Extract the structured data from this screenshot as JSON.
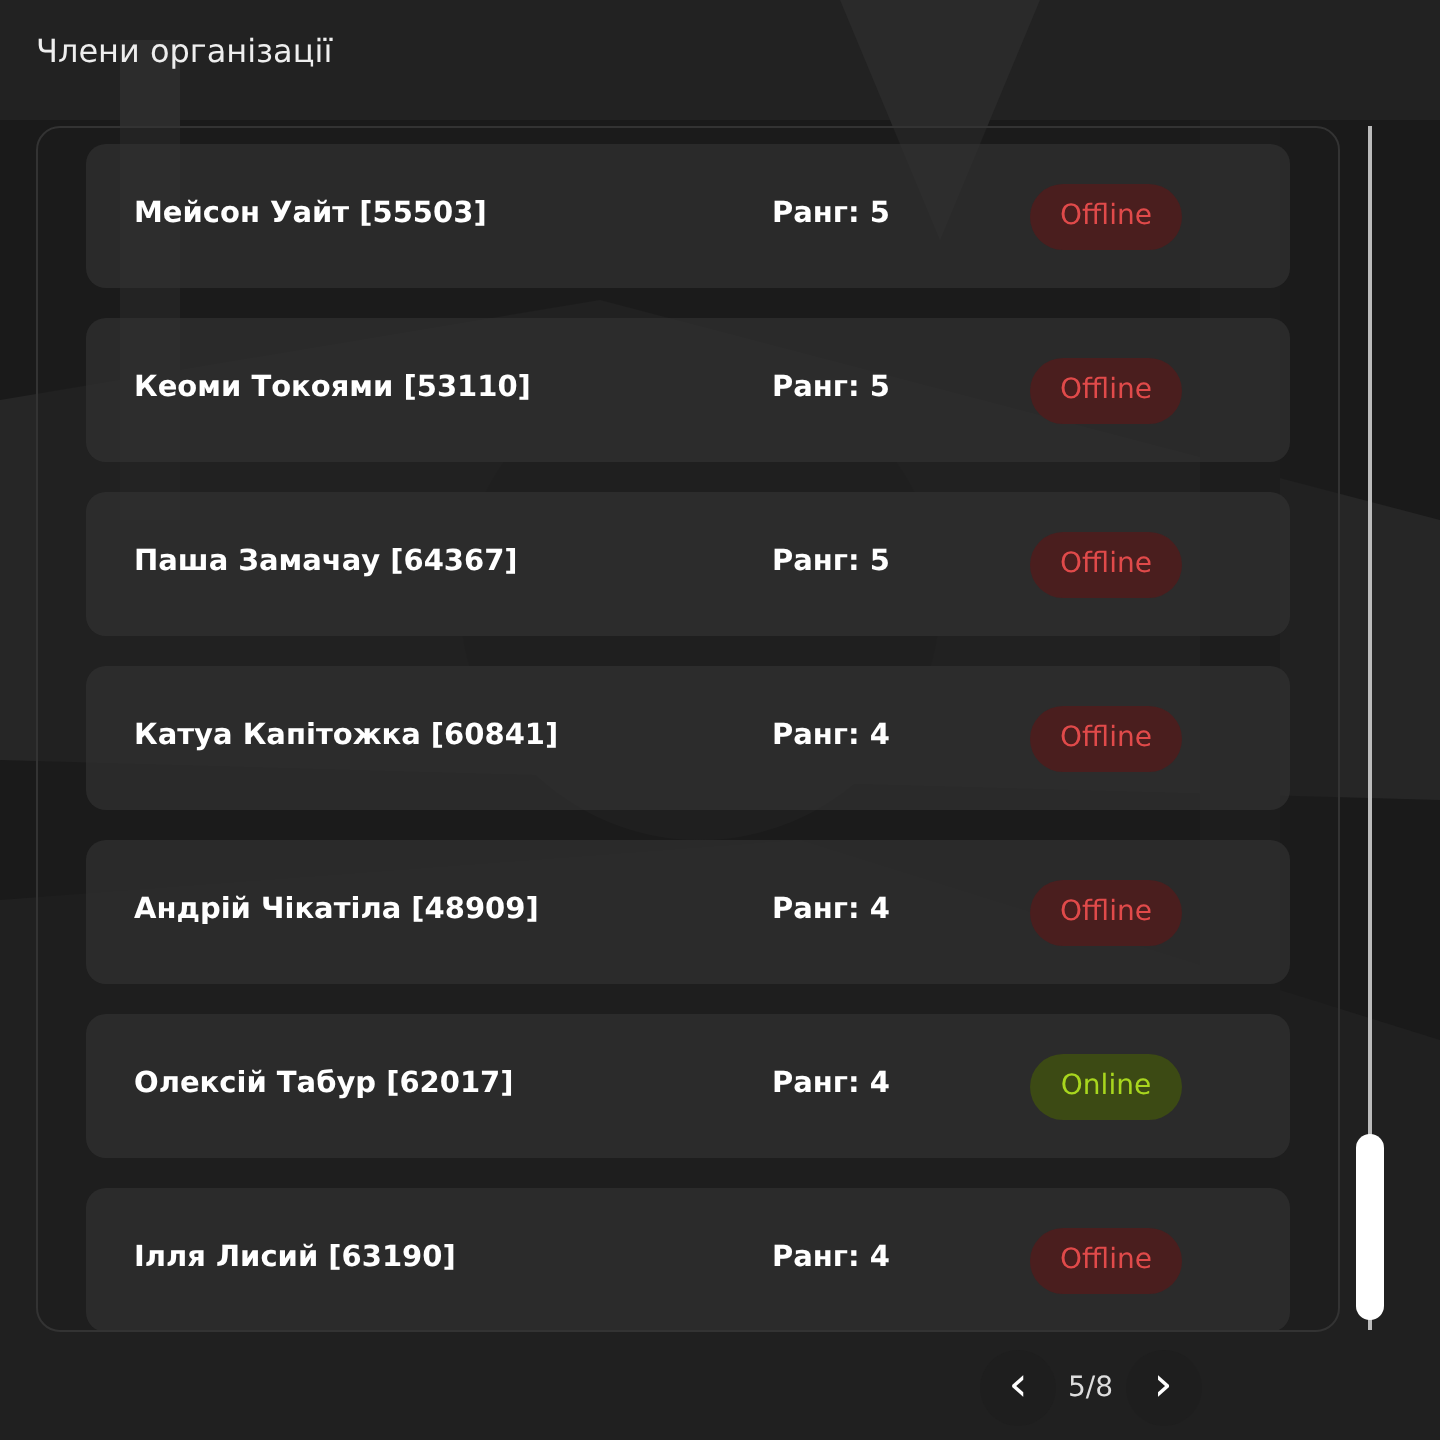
{
  "title": "Члени організації",
  "members": [
    {
      "name": "Мейсон Уайт [55503]",
      "rank": "Ранг: 5",
      "status": "Offline",
      "online": false
    },
    {
      "name": "Кеоми Токоями [53110]",
      "rank": "Ранг: 5",
      "status": "Offline",
      "online": false
    },
    {
      "name": "Паша Замачау [64367]",
      "rank": "Ранг: 5",
      "status": "Offline",
      "online": false
    },
    {
      "name": "Катуа Капітожка [60841]",
      "rank": "Ранг: 4",
      "status": "Offline",
      "online": false
    },
    {
      "name": "Андрій Чікатіла [48909]",
      "rank": "Ранг: 4",
      "status": "Offline",
      "online": false
    },
    {
      "name": "Олексій Табур [62017]",
      "rank": "Ранг: 4",
      "status": "Online",
      "online": true
    },
    {
      "name": "Ілля Лисий [63190]",
      "rank": "Ранг: 4",
      "status": "Offline",
      "online": false
    }
  ],
  "pagination": {
    "prev": "‹",
    "page": "5/8",
    "next": "›"
  }
}
